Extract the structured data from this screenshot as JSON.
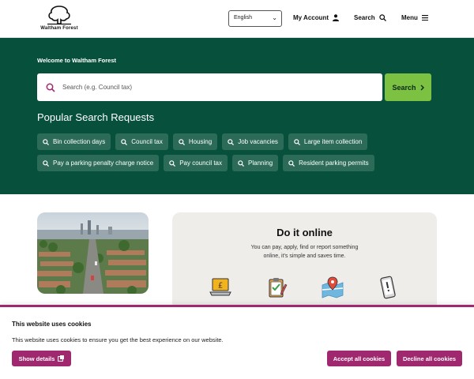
{
  "header": {
    "logo_text": "Waltham Forest",
    "language": "English",
    "account_label": "My Account",
    "search_label": "Search",
    "menu_label": "Menu"
  },
  "hero": {
    "welcome": "Welcome to Waltham Forest",
    "search_placeholder": "Search (e.g. Council tax)",
    "search_button": "Search",
    "popular_title": "Popular Search Requests",
    "chips_row1": [
      "Bin collection days",
      "Council tax",
      "Housing",
      "Job vacancies",
      "Large item collection"
    ],
    "chips_row2": [
      "Pay a parking penalty charge notice",
      "Pay council tax",
      "Planning",
      "Resident parking permits"
    ]
  },
  "doit": {
    "title": "Do it online",
    "line1": "You can pay, apply, find or report something",
    "line2": "online, it's simple and saves time."
  },
  "cookie": {
    "title": "This website uses cookies",
    "text": "This website uses cookies to ensure you get the best experience on our website.",
    "details_button": "Show details",
    "accept_button": "Accept all cookies",
    "decline_button": "Decline all cookies"
  },
  "colors": {
    "hero_bg": "#07503c",
    "chip_bg": "#2b6b58",
    "search_button_bg": "#7cc142",
    "cookie_accent": "#a0286f"
  },
  "icons": [
    "tree-logo-icon",
    "chevron-down-icon",
    "user-icon",
    "search-icon",
    "menu-icon",
    "chevron-right-icon",
    "laptop-pound-icon",
    "clipboard-check-icon",
    "map-pin-icon",
    "phone-alert-icon",
    "external-link-icon"
  ]
}
